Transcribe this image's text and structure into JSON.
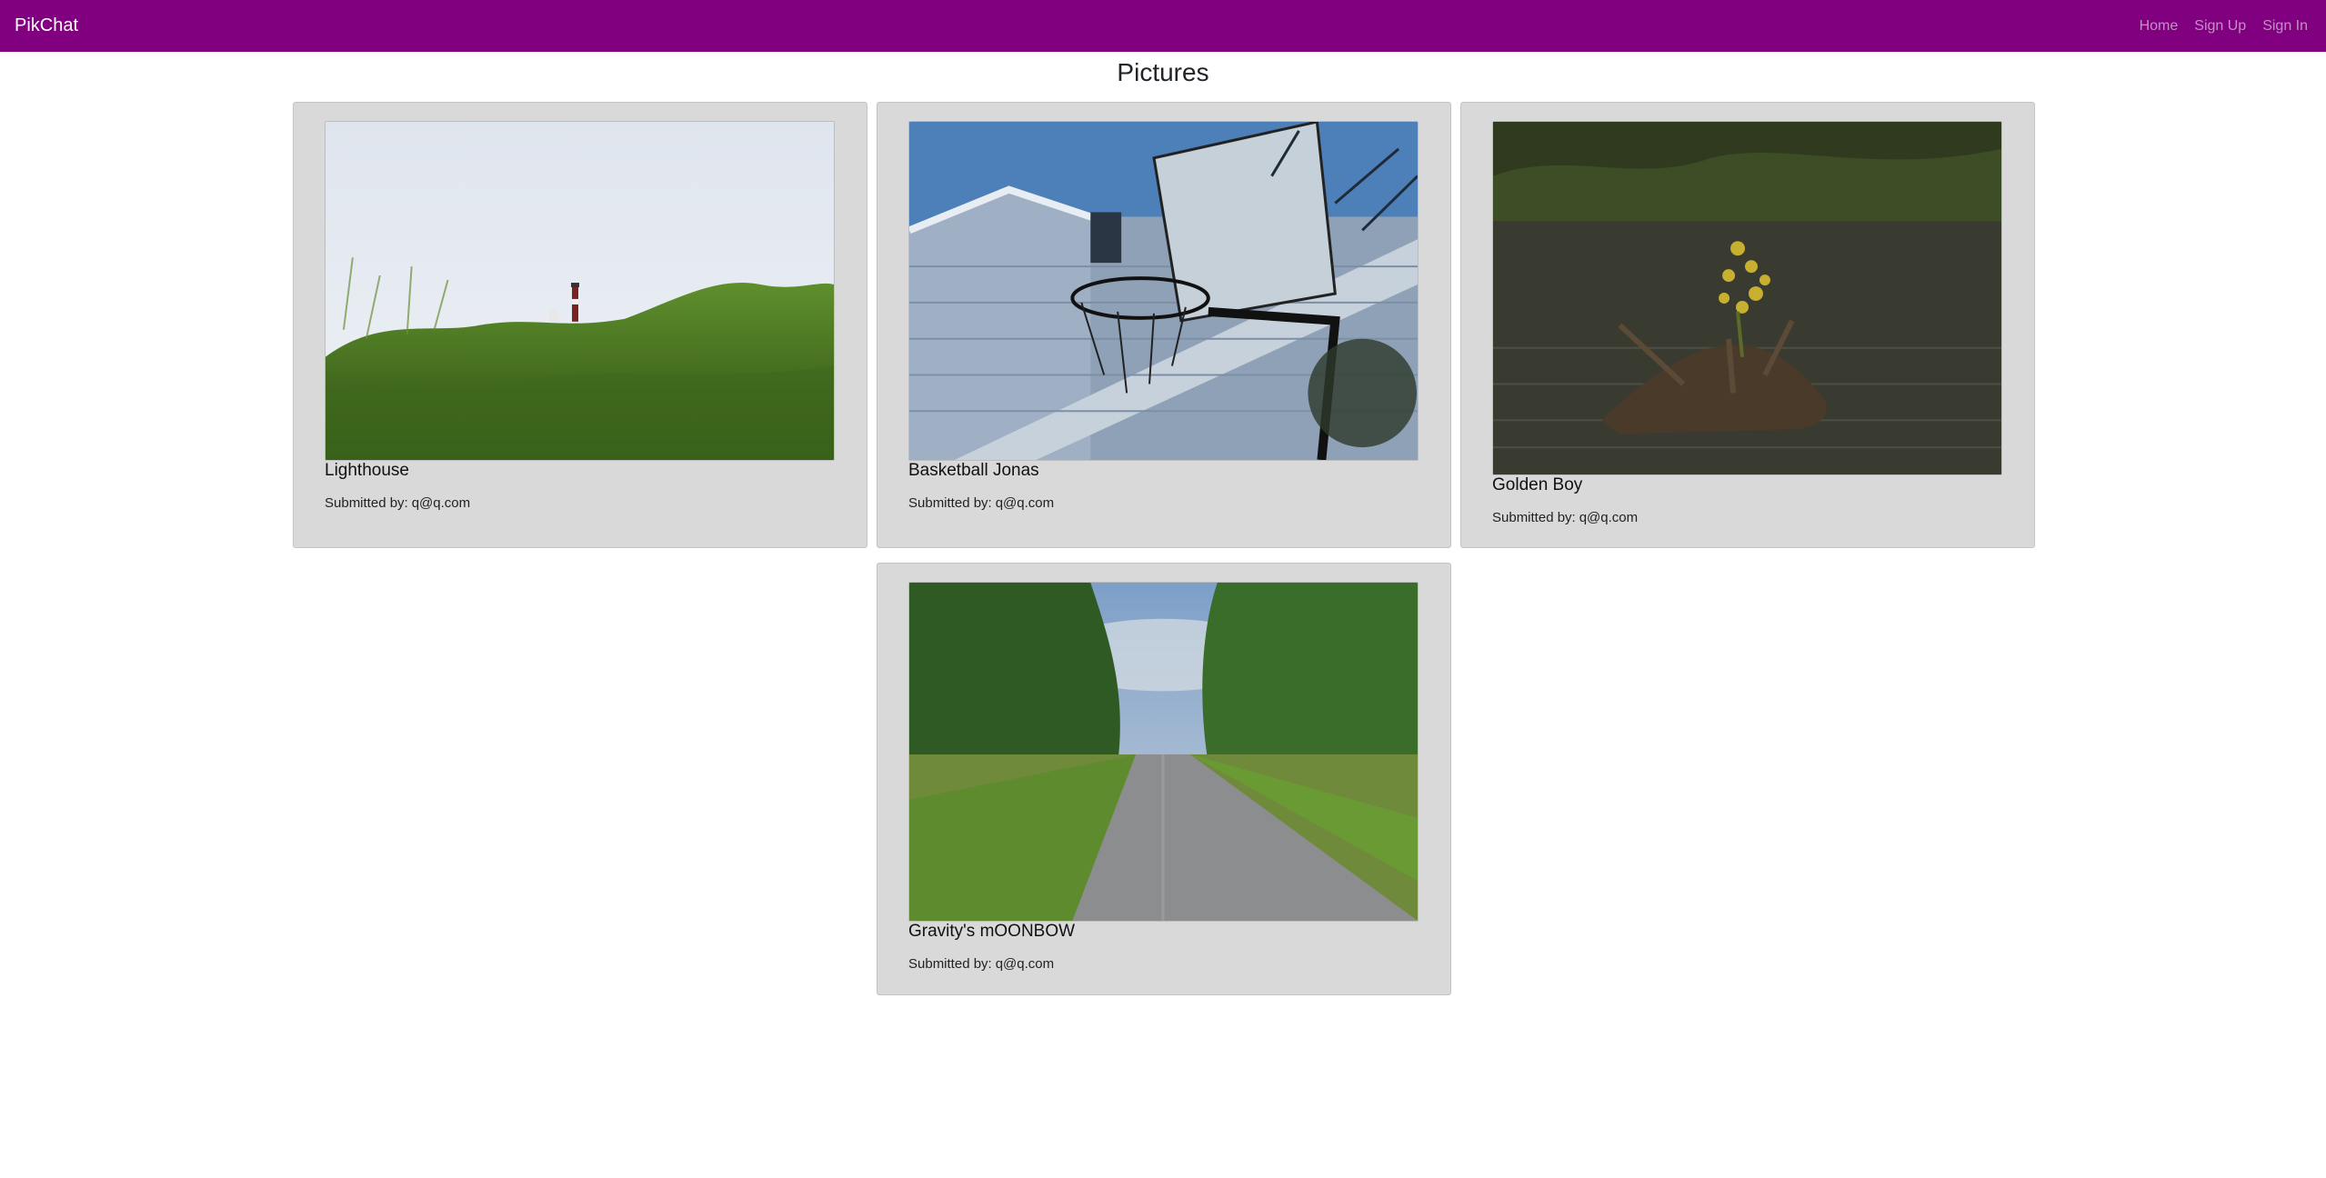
{
  "navbar": {
    "brand": "PikChat",
    "links": [
      {
        "label": "Home"
      },
      {
        "label": "Sign Up"
      },
      {
        "label": "Sign In"
      }
    ],
    "background": "#800080"
  },
  "page": {
    "title": "Pictures"
  },
  "submitted_prefix": "Submitted by:",
  "pictures": [
    {
      "title": "Lighthouse",
      "submitted_by": "q@q.com",
      "image": "lighthouse-photo"
    },
    {
      "title": "Basketball Jonas",
      "submitted_by": "q@q.com",
      "image": "basketball-hoop-photo"
    },
    {
      "title": "Golden Boy",
      "submitted_by": "q@q.com",
      "image": "pond-flower-photo"
    },
    {
      "title": "Gravity's mOONBOW",
      "submitted_by": "q@q.com",
      "image": "country-road-photo"
    }
  ]
}
